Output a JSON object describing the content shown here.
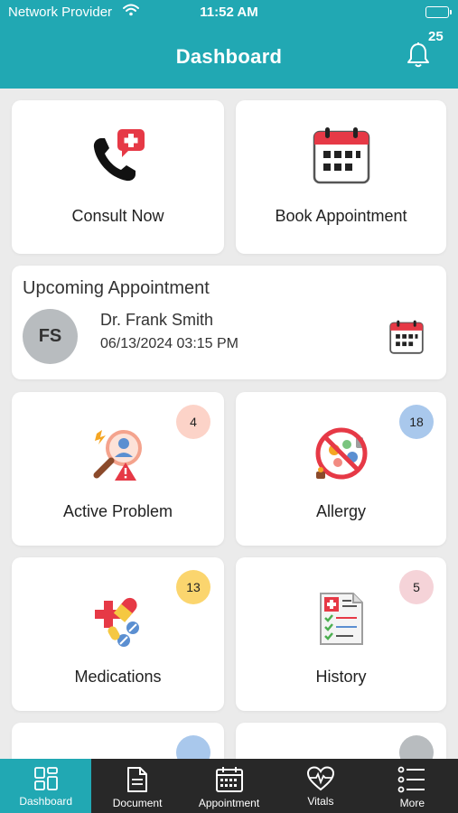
{
  "status_bar": {
    "carrier": "Network Provider",
    "time": "11:52 AM"
  },
  "header": {
    "title": "Dashboard",
    "notification_count": "25",
    "color": "#21a8b3"
  },
  "quick_actions": [
    {
      "label": "Consult Now",
      "icon": "phone-medical-icon"
    },
    {
      "label": "Book Appointment",
      "icon": "calendar-icon"
    }
  ],
  "upcoming": {
    "title": "Upcoming Appointment",
    "initials": "FS",
    "doctor": "Dr. Frank Smith",
    "datetime": "06/13/2024 03:15 PM"
  },
  "tiles": [
    {
      "label": "Active Problem",
      "count": "4",
      "badge_color": "#fcd3c8",
      "icon": "diagnosis-magnifier-icon"
    },
    {
      "label": "Allergy",
      "count": "18",
      "badge_color": "#a9c8ec",
      "icon": "no-allergen-icon"
    },
    {
      "label": "Medications",
      "count": "13",
      "badge_color": "#fbd56e",
      "icon": "pills-icon"
    },
    {
      "label": "History",
      "count": "5",
      "badge_color": "#f5d3d8",
      "icon": "medical-record-icon"
    }
  ],
  "partial_badge_colors": [
    "#a9c8ec",
    "#b8bcbf"
  ],
  "tabbar": {
    "items": [
      {
        "label": "Dashboard",
        "icon": "dashboard-grid-icon",
        "active": true
      },
      {
        "label": "Document",
        "icon": "document-icon"
      },
      {
        "label": "Appointment",
        "icon": "calendar-icon"
      },
      {
        "label": "Vitals",
        "icon": "heart-pulse-icon"
      },
      {
        "label": "More",
        "icon": "list-icon"
      }
    ]
  }
}
